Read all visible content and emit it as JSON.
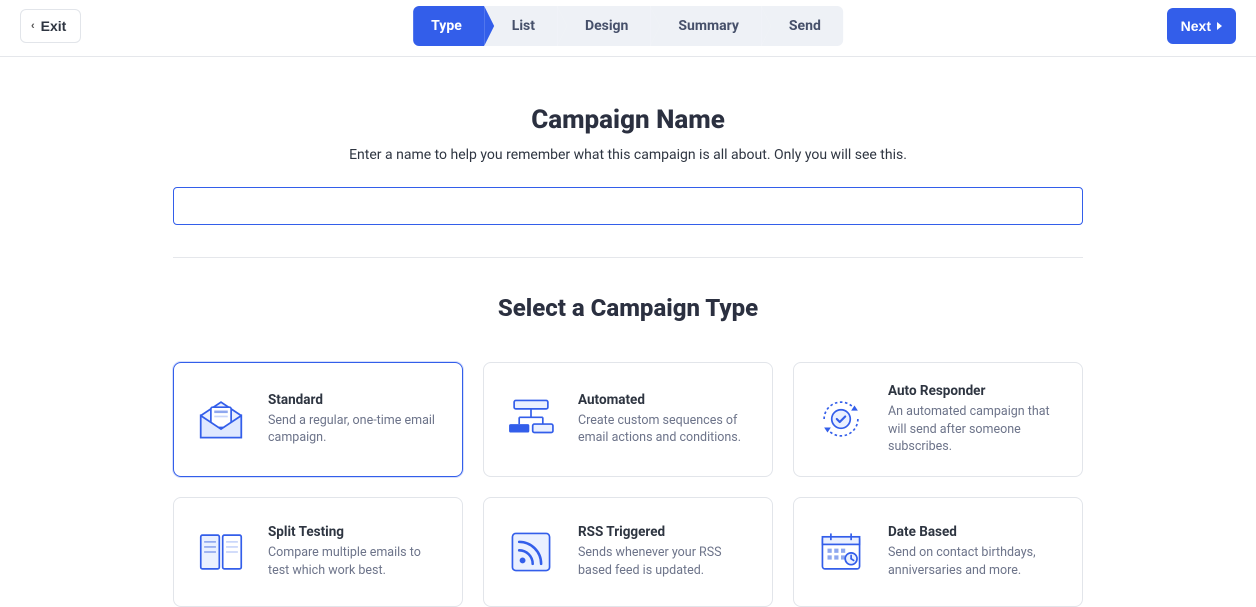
{
  "header": {
    "exit_label": "Exit",
    "next_label": "Next"
  },
  "steps": [
    {
      "label": "Type",
      "active": true
    },
    {
      "label": "List",
      "active": false
    },
    {
      "label": "Design",
      "active": false
    },
    {
      "label": "Summary",
      "active": false
    },
    {
      "label": "Send",
      "active": false
    }
  ],
  "campaign_name": {
    "heading": "Campaign Name",
    "description": "Enter a name to help you remember what this campaign is all about. Only you will see this.",
    "value": "",
    "placeholder": ""
  },
  "type_section": {
    "heading": "Select a Campaign Type"
  },
  "types": [
    {
      "icon": "envelope-open-icon",
      "title": "Standard",
      "desc": "Send a regular, one-time email campaign.",
      "selected": true
    },
    {
      "icon": "flowchart-icon",
      "title": "Automated",
      "desc": "Create custom sequences of email actions and conditions.",
      "selected": false
    },
    {
      "icon": "check-cycle-icon",
      "title": "Auto Responder",
      "desc": "An automated campaign that will send after someone subscribes.",
      "selected": false
    },
    {
      "icon": "split-test-icon",
      "title": "Split Testing",
      "desc": "Compare multiple emails to test which work best.",
      "selected": false
    },
    {
      "icon": "rss-icon",
      "title": "RSS Triggered",
      "desc": "Sends whenever your RSS based feed is updated.",
      "selected": false
    },
    {
      "icon": "calendar-icon",
      "title": "Date Based",
      "desc": "Send on contact birthdays, anniversaries and more.",
      "selected": false
    }
  ],
  "colors": {
    "accent": "#335eea"
  }
}
